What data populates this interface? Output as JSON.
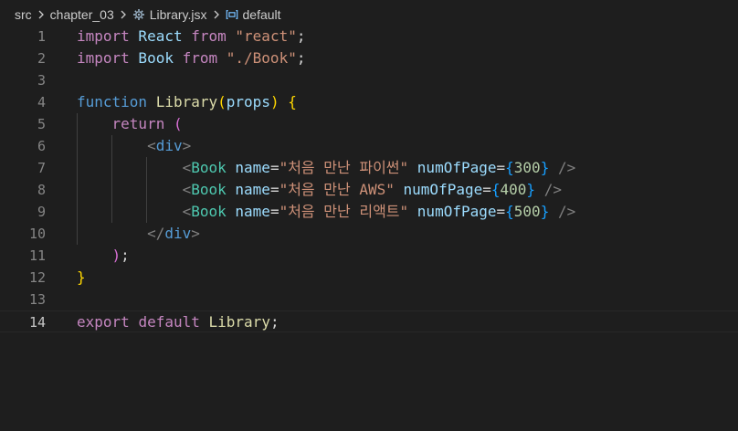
{
  "breadcrumb": {
    "items": [
      {
        "label": "src"
      },
      {
        "label": "chapter_03"
      },
      {
        "label": "Library.jsx"
      },
      {
        "label": "default"
      }
    ],
    "icons": {
      "file": "react-gear-icon",
      "symbol": "symbol-variable-icon",
      "separator": "chevron-right-icon"
    }
  },
  "editor": {
    "current_line": 14,
    "line_numbers": [
      "1",
      "2",
      "3",
      "4",
      "5",
      "6",
      "7",
      "8",
      "9",
      "10",
      "11",
      "12",
      "13",
      "14"
    ],
    "lines": [
      {
        "t1": "import",
        "t2": " React ",
        "t3": "from",
        "t4": " ",
        "t5": "\"react\"",
        "t6": ";"
      },
      {
        "t1": "import",
        "t2": " Book ",
        "t3": "from",
        "t4": " ",
        "t5": "\"./Book\"",
        "t6": ";"
      },
      {},
      {
        "t1": "function",
        "t2": " ",
        "t3": "Library",
        "t4": "(",
        "t5": "props",
        "t6": ")",
        "t7": " ",
        "t8": "{"
      },
      {
        "t1": "    ",
        "t2": "return",
        "t3": " ",
        "t4": "("
      },
      {
        "t1": "        ",
        "t2": "<",
        "t3": "div",
        "t4": ">"
      },
      {
        "t1": "            ",
        "t2": "<",
        "t3": "Book",
        "t4": " ",
        "t5": "name",
        "t6": "=",
        "t7": "\"처음 만난 파이썬\"",
        "t8": " ",
        "t9": "numOfPage",
        "t10": "=",
        "t11": "{",
        "t12": "300",
        "t13": "}",
        "t14": " ",
        "t15": "/>"
      },
      {
        "t1": "            ",
        "t2": "<",
        "t3": "Book",
        "t4": " ",
        "t5": "name",
        "t6": "=",
        "t7": "\"처음 만난 AWS\"",
        "t8": " ",
        "t9": "numOfPage",
        "t10": "=",
        "t11": "{",
        "t12": "400",
        "t13": "}",
        "t14": " ",
        "t15": "/>"
      },
      {
        "t1": "            ",
        "t2": "<",
        "t3": "Book",
        "t4": " ",
        "t5": "name",
        "t6": "=",
        "t7": "\"처음 만난 리액트\"",
        "t8": " ",
        "t9": "numOfPage",
        "t10": "=",
        "t11": "{",
        "t12": "500",
        "t13": "}",
        "t14": " ",
        "t15": "/>"
      },
      {
        "t1": "        ",
        "t2": "</",
        "t3": "div",
        "t4": ">"
      },
      {
        "t1": "    ",
        "t2": ")",
        "t3": ";"
      },
      {
        "t1": "}"
      },
      {},
      {
        "t1": "export",
        "t2": " ",
        "t3": "default",
        "t4": " ",
        "t5": "Library",
        "t6": ";"
      }
    ]
  },
  "colors": {
    "background": "#1e1e1e",
    "keyword": "#569cd6",
    "control": "#c586c0",
    "function": "#dcdcaa",
    "string": "#ce9178",
    "attribute": "#9cdcfe",
    "component": "#4ec9b0",
    "bracket_level1": "#ffd700",
    "bracket_level2": "#da70d6",
    "bracket_level3": "#179fff"
  }
}
